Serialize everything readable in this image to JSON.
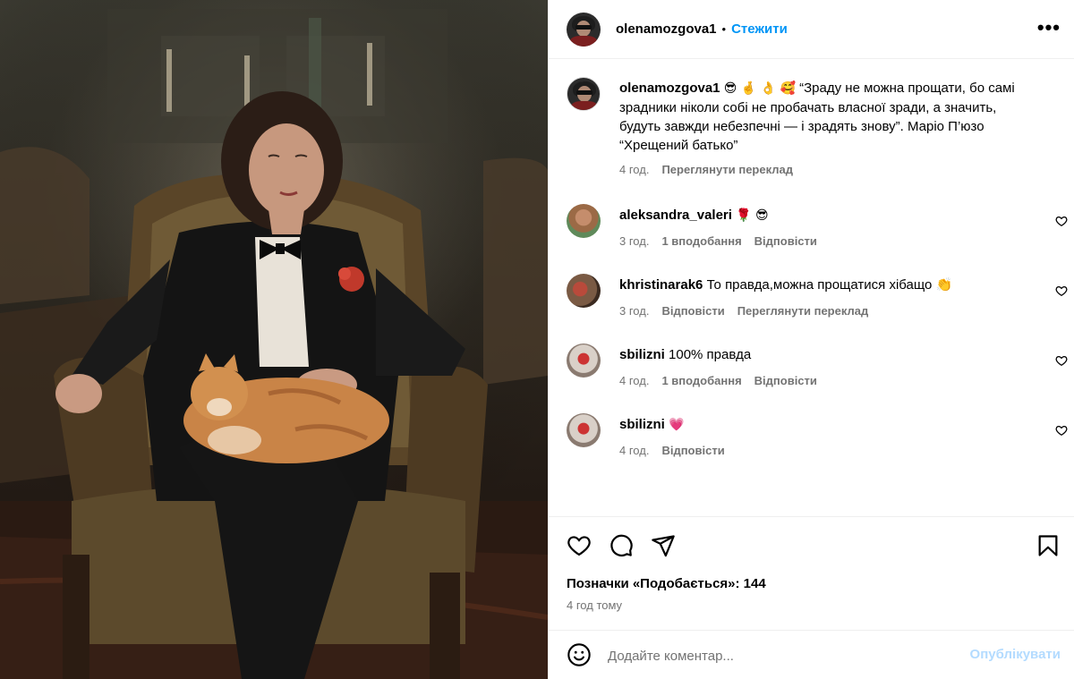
{
  "post": {
    "author": "olenamozgova1",
    "separator": "•",
    "follow_label": "Стежити",
    "more_label": "•••",
    "caption": {
      "username": "olenamozgova1",
      "emojis": "😎 🤞 👌 🥰",
      "text": "“Зраду не можна прощати, бо самі зрадники ніколи собі не пробачать власної зради, а значить, будуть завжди небезпечні — і зрадять знову”. Маріо П’юзо “Хрещений батько”",
      "time": "4 год.",
      "translate_label": "Переглянути переклад"
    },
    "comments": [
      {
        "username": "aleksandra_valeri",
        "text": "🌹 😎",
        "time": "3 год.",
        "likes": "1 вподобання",
        "reply": "Відповісти",
        "translate": ""
      },
      {
        "username": "khristinarak6",
        "text": "То правда,можна прощатися хібащо 👏",
        "time": "3 год.",
        "likes": "",
        "reply": "Відповісти",
        "translate": "Переглянути переклад"
      },
      {
        "username": "sbilizni",
        "text": "100% правда",
        "time": "4 год.",
        "likes": "1 вподобання",
        "reply": "Відповісти",
        "translate": ""
      },
      {
        "username": "sbilizni",
        "text": "💗",
        "time": "4 год.",
        "likes": "",
        "reply": "Відповісти",
        "translate": ""
      }
    ],
    "likes_text": "Позначки «Подобається»: 144",
    "time_ago": "4 год тому",
    "add_comment": {
      "placeholder": "Додайте коментар...",
      "post_label": "Опублікувати"
    }
  },
  "colors": {
    "accent": "#0095f6",
    "post_disabled": "#b3dbff",
    "muted": "#737373",
    "divider": "#efefef"
  },
  "icons": [
    "more-icon",
    "heart-icon",
    "comment-icon",
    "share-icon",
    "bookmark-icon",
    "emoji-icon"
  ]
}
